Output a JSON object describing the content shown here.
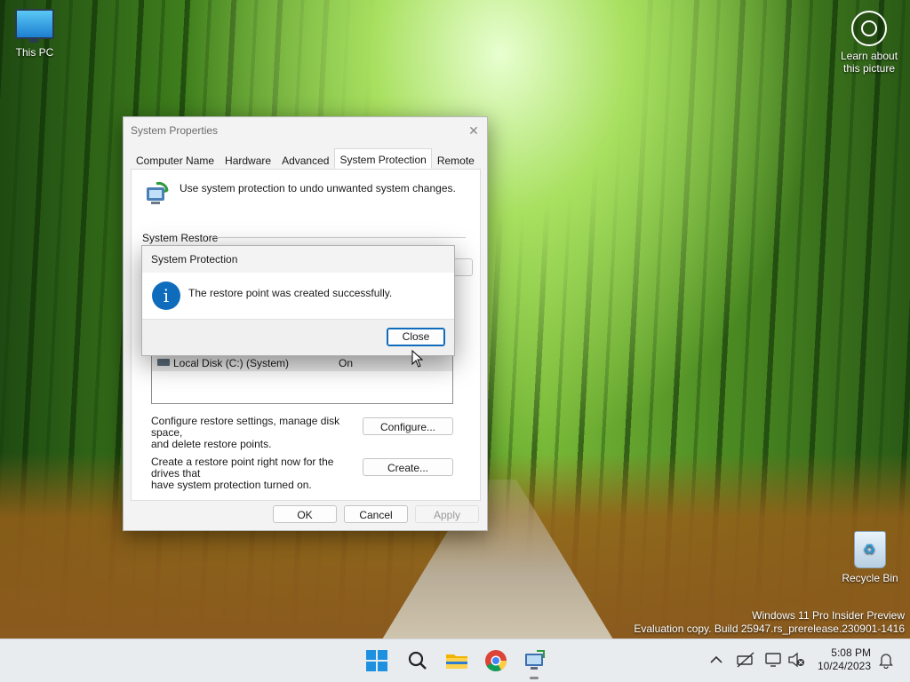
{
  "desktop": {
    "this_pc_label": "This PC",
    "learn_label_1": "Learn about",
    "learn_label_2": "this picture",
    "recycle_label": "Recycle Bin",
    "watermark_line1": "Windows 11 Pro Insider Preview",
    "watermark_line2": "Evaluation copy. Build 25947.rs_prerelease.230901-1416"
  },
  "system_properties": {
    "title": "System Properties",
    "close_glyph": "✕",
    "tabs": [
      {
        "label": "Computer Name"
      },
      {
        "label": "Hardware"
      },
      {
        "label": "Advanced"
      },
      {
        "label": "System Protection"
      },
      {
        "label": "Remote"
      }
    ],
    "intro_text": "Use system protection to undo unwanted system changes.",
    "system_restore_label": "System Restore",
    "drive": {
      "name": "Local Disk (C:) (System)",
      "status": "On"
    },
    "configure_desc_1": "Configure restore settings, manage disk space,",
    "configure_desc_2": "and delete restore points.",
    "configure_button": "Configure...",
    "create_desc_1": "Create a restore point right now for the drives that",
    "create_desc_2": "have system protection turned on.",
    "create_button": "Create...",
    "ok_button": "OK",
    "cancel_button": "Cancel",
    "apply_button": "Apply"
  },
  "dialog": {
    "title": "System Protection",
    "info_glyph": "i",
    "message": "The restore point was created successfully.",
    "close_button": "Close"
  },
  "taskbar": {
    "time": "5:08 PM",
    "date": "10/24/2023",
    "accent_color": "#1e90e0"
  }
}
